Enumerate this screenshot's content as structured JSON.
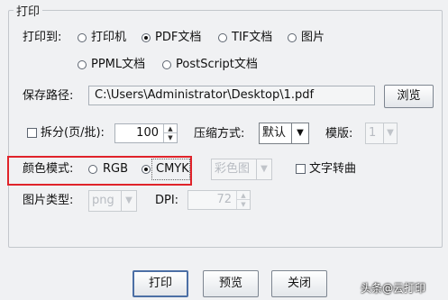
{
  "group_title": "打印",
  "print_to": {
    "label": "打印到:",
    "options": [
      "打印机",
      "PDF文档",
      "TIF文档",
      "图片",
      "PPML文档",
      "PostScript文档"
    ],
    "selected": "PDF文档"
  },
  "save_path": {
    "label": "保存路径:",
    "value": "C:\\Users\\Administrator\\Desktop\\1.pdf",
    "browse_label": "浏览"
  },
  "split": {
    "label": "拆分(页/批):",
    "checked": false,
    "value": "100"
  },
  "compression": {
    "label": "压缩方式:",
    "value": "默认"
  },
  "template": {
    "label": "模版:",
    "value": "1"
  },
  "color_mode": {
    "label": "颜色模式:",
    "options": [
      "RGB",
      "CMYK"
    ],
    "selected": "CMYK",
    "color_select_value": "彩色图",
    "text_to_curve_label": "文字转曲",
    "highlight_color": "#e0232a"
  },
  "image_type": {
    "label": "图片类型:",
    "value": "png"
  },
  "dpi": {
    "label": "DPI:",
    "value": "72"
  },
  "footer": {
    "print_label": "打印",
    "preview_label": "预览",
    "close_label": "关闭"
  },
  "watermark": {
    "text": "头条@云打印"
  }
}
